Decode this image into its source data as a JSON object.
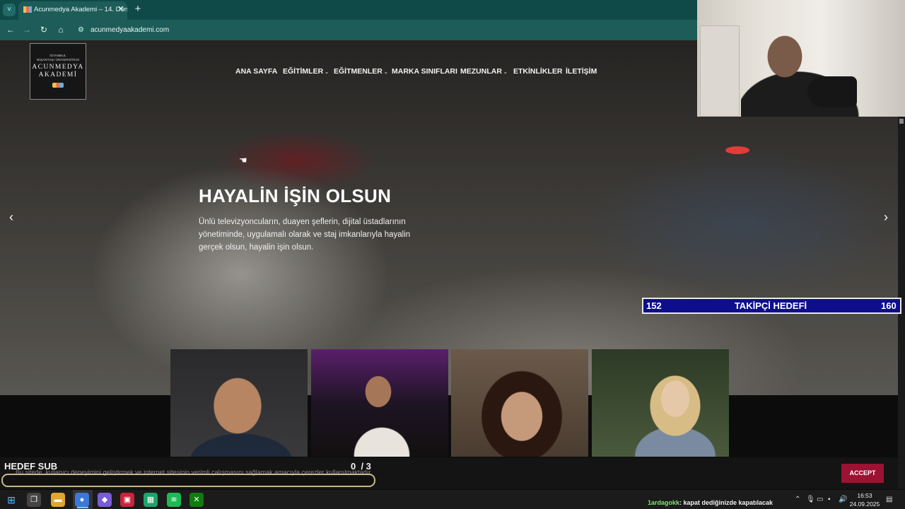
{
  "browser": {
    "menu_icon": "˅",
    "tab_title": "Acunmedya Akademi – 14. Dön",
    "tab_close": "✕",
    "new_tab": "+",
    "back": "←",
    "forward": "→",
    "reload": "↻",
    "home": "⌂",
    "url": "acunmedyaakademi.com",
    "url_icon": "⚙"
  },
  "site": {
    "logo_sub": "İSTANBUL\nNİŞANTAŞI ÜNİVERSİTESİ",
    "logo_main": "ACUNMEDYA\nAKADEMİ",
    "menu": [
      {
        "label": "ANA SAYFA",
        "caret": false
      },
      {
        "label": "EĞİTİMLER",
        "caret": true
      },
      {
        "label": "EĞİTMENLER",
        "caret": true
      },
      {
        "label": "MARKA SINIFLARI",
        "caret": false
      },
      {
        "label": "MEZUNLAR",
        "caret": true
      },
      {
        "label": "ETKİNLİKLER",
        "caret": false
      },
      {
        "label": "İLETİŞİM",
        "caret": false
      }
    ],
    "caret_symbol": "⌄",
    "hero_title": "HAYALİN İŞİN OLSUN",
    "hero_desc": "Ünlü televizyoncuların, duayen şeflerin, dijital üstadlarının yönetiminde, uygulamalı olarak ve staj imkanlarıyla hayalin gerçek olsun, hayalin işin olsun.",
    "prev_arrow": "‹",
    "next_arrow": "›",
    "cookie_text": "Bu sitede, kullanıcı deneyimini geliştirmek ve internet sitesinin verimli çalışmasını sağlamak amacıyla çerezler kullanılmaktadır.",
    "accept_label": "ACCEPT"
  },
  "stream": {
    "follower_goal": {
      "title": "TAKİPÇİ HEDEFİ",
      "current": "152",
      "target": "160"
    },
    "sub_goal": {
      "label": "HEDEF SUB",
      "current": 0,
      "target": 3,
      "count_text": "0  / 3"
    },
    "chat": {
      "user": "1ardagokk",
      "message": ": kapat dediğinizde kapatılacak"
    }
  },
  "taskbar": {
    "start_icon": "⊞",
    "icons": [
      {
        "name": "task-view-icon",
        "glyph": "❐",
        "color": "#444"
      },
      {
        "name": "file-explorer-icon",
        "glyph": "▬",
        "color": "#e0a630"
      },
      {
        "name": "chrome-icon",
        "glyph": "●",
        "color": "#3b79d9"
      },
      {
        "name": "copilot-icon",
        "glyph": "◆",
        "color": "#7a5cd6"
      },
      {
        "name": "app-red-icon",
        "glyph": "▣",
        "color": "#c8243b"
      },
      {
        "name": "app-green-icon",
        "glyph": "▦",
        "color": "#1fa36a"
      },
      {
        "name": "spotify-icon",
        "glyph": "≋",
        "color": "#1db954"
      },
      {
        "name": "xbox-icon",
        "glyph": "✕",
        "color": "#107c10"
      }
    ],
    "tray": {
      "chevron": "⌃",
      "mic": "🎙",
      "display": "▭",
      "network": "▪",
      "volume": "🔊",
      "notify": "▤"
    },
    "time": "16:53",
    "date": "24.09.2025"
  },
  "colors": {
    "browser_bar": "#0f4a48",
    "accept": "#9b1232",
    "goal_bg": "#0e0e8c",
    "chat_user": "#7ee36f"
  }
}
